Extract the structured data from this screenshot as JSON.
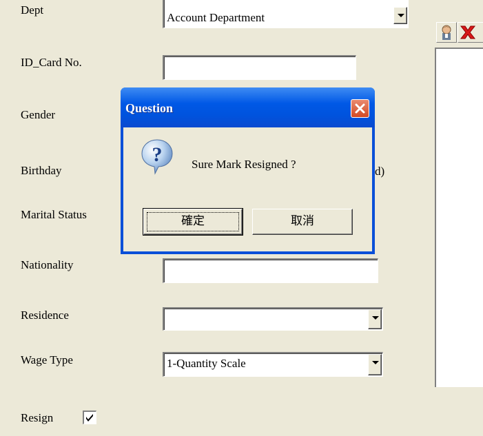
{
  "form": {
    "dept_label": "Dept",
    "dept_value": "Account Department",
    "id_card_label": "ID_Card No.",
    "id_card_value": "",
    "gender_label": "Gender",
    "birthday_label": "Birthday",
    "birthday_suffix": "d)",
    "marital_label": "Marital Status",
    "nationality_label": "Nationality",
    "nationality_value": "",
    "residence_label": "Residence",
    "residence_value": "",
    "wage_label": "Wage Type",
    "wage_value": "1-Quantity Scale",
    "resign_label": "Resign",
    "resign_checked": true
  },
  "dialog": {
    "title": "Question",
    "message": "Sure Mark Resigned ?",
    "ok_label": "確定",
    "cancel_label": "取消",
    "icon": "question-icon"
  },
  "toolbar": {
    "icons": [
      "user-icon",
      "delete-icon"
    ]
  }
}
